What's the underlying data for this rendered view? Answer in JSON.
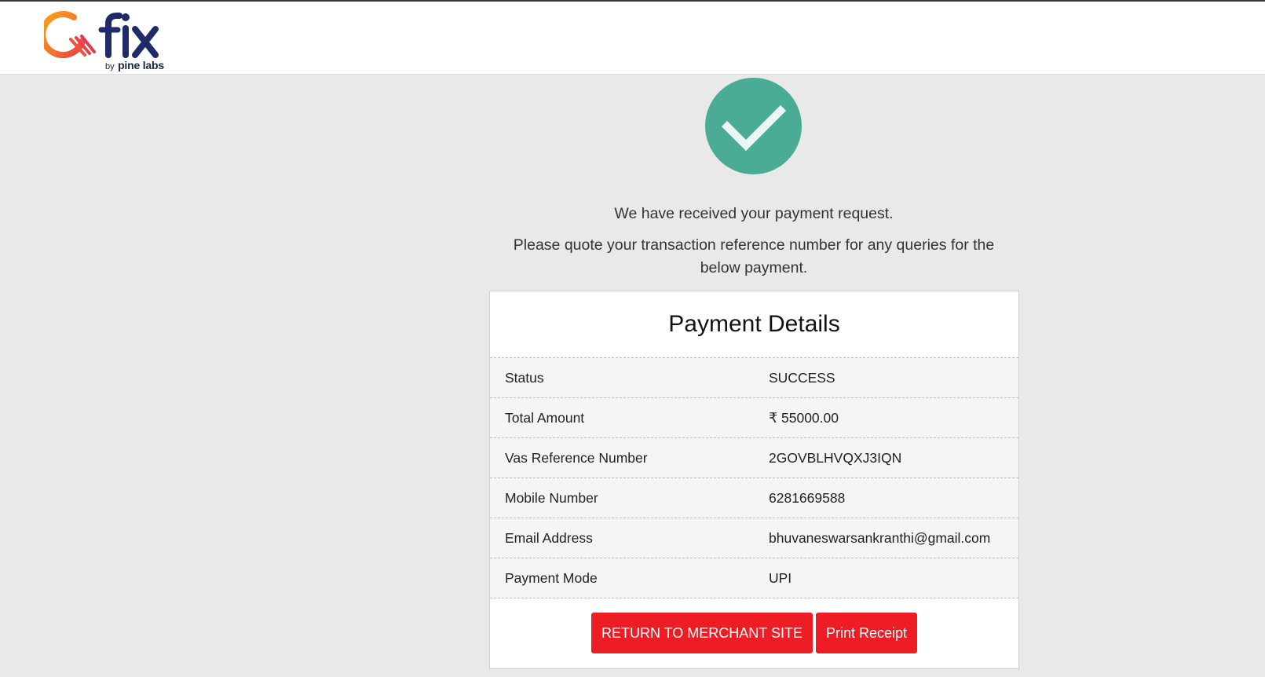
{
  "header": {
    "logo_text": "Qfix",
    "logo_by": "by",
    "logo_company": "pine labs"
  },
  "status_icon": "check-circle-icon",
  "messages": {
    "received": "We have received your payment request.",
    "quote": "Please quote your transaction reference number for any queries for the below payment."
  },
  "payment_details": {
    "title": "Payment Details",
    "rows": [
      {
        "label": "Status",
        "value": "SUCCESS"
      },
      {
        "label": "Total Amount",
        "value": "₹ 55000.00"
      },
      {
        "label": "Vas Reference Number",
        "value": "2GOVBLHVQXJ3IQN"
      },
      {
        "label": "Mobile Number",
        "value": "6281669588"
      },
      {
        "label": "Email Address",
        "value": "bhuvaneswarsankranthi@gmail.com"
      },
      {
        "label": "Payment Mode",
        "value": "UPI"
      }
    ]
  },
  "actions": {
    "return_label": "RETURN TO MERCHANT SITE",
    "print_label": "Print Receipt"
  },
  "colors": {
    "success_green": "#4aac95",
    "button_red": "#ee1c25",
    "logo_orange": "#f58a1f",
    "logo_navy": "#1f2a68"
  }
}
